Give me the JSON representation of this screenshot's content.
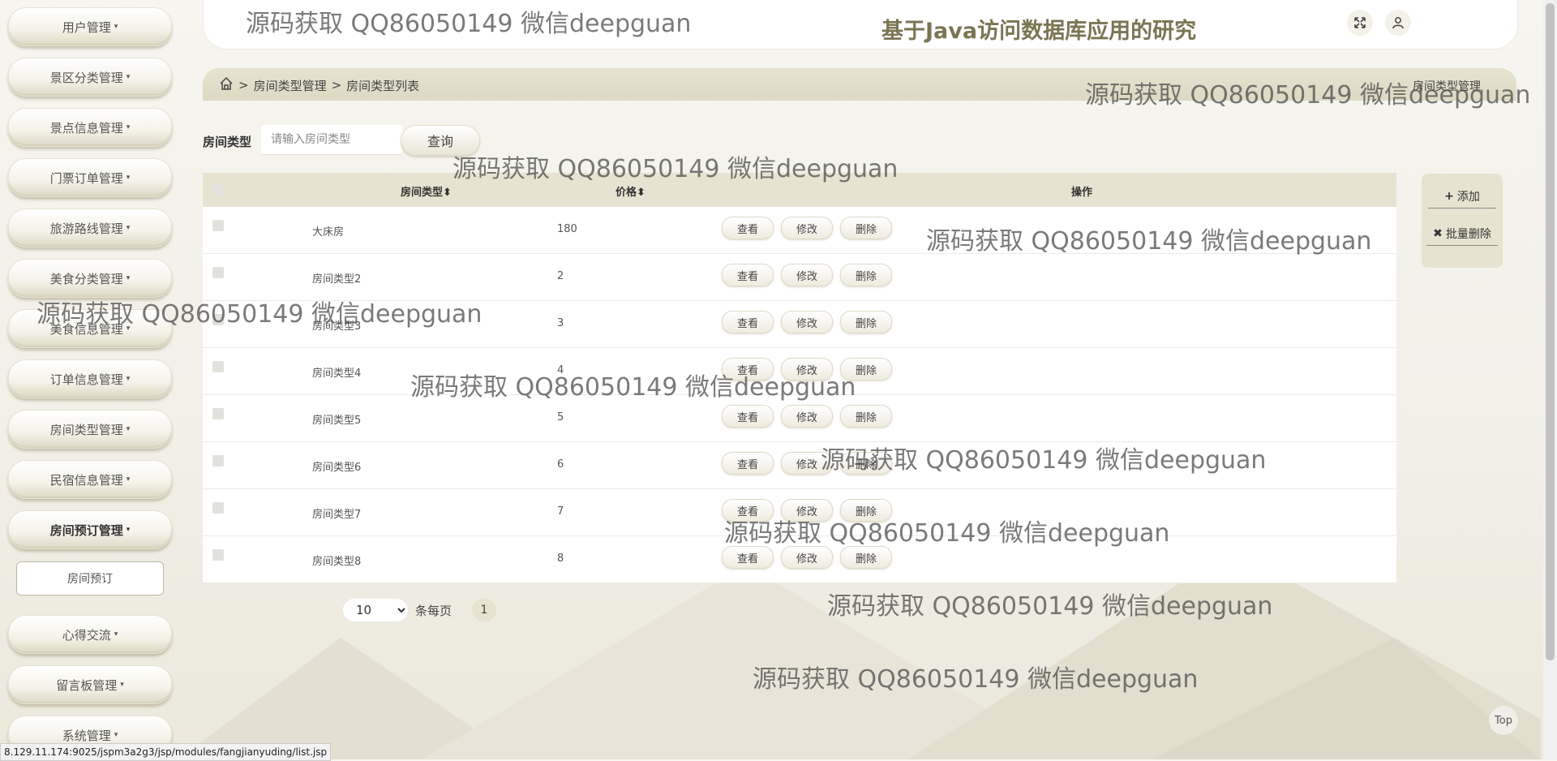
{
  "header": {
    "title": "基于Java访问数据库应用的研究"
  },
  "sidebar": {
    "items": [
      {
        "label": "用户管理"
      },
      {
        "label": "景区分类管理"
      },
      {
        "label": "景点信息管理"
      },
      {
        "label": "门票订单管理"
      },
      {
        "label": "旅游路线管理"
      },
      {
        "label": "美食分类管理"
      },
      {
        "label": "美食信息管理"
      },
      {
        "label": "订单信息管理"
      },
      {
        "label": "房间类型管理"
      },
      {
        "label": "民宿信息管理"
      },
      {
        "label": "房间预订管理"
      },
      {
        "label": "心得交流"
      },
      {
        "label": "留言板管理"
      },
      {
        "label": "系统管理"
      }
    ],
    "submenu": {
      "label": "房间预订"
    }
  },
  "breadcrumb": {
    "home_icon": "home-icon",
    "sep": ">",
    "level1": "房间类型管理",
    "level2": "房间类型列表",
    "right": "房间类型管理"
  },
  "search": {
    "label": "房间类型",
    "placeholder": "请输入房间类型",
    "button": "查询"
  },
  "table": {
    "headers": {
      "type": "房间类型",
      "price": "价格",
      "ops": "操作"
    },
    "rows": [
      {
        "type": "大床房",
        "price": "180"
      },
      {
        "type": "房间类型2",
        "price": "2"
      },
      {
        "type": "房间类型3",
        "price": "3"
      },
      {
        "type": "房间类型4",
        "price": "4"
      },
      {
        "type": "房间类型5",
        "price": "5"
      },
      {
        "type": "房间类型6",
        "price": "6"
      },
      {
        "type": "房间类型7",
        "price": "7"
      },
      {
        "type": "房间类型8",
        "price": "8"
      }
    ],
    "actions": {
      "view": "查看",
      "edit": "修改",
      "delete": "删除"
    }
  },
  "right_panel": {
    "add": "添加",
    "batch_delete": "批量删除"
  },
  "pagination": {
    "page_size": "10",
    "per_page_label": "条每页",
    "current_page": "1"
  },
  "top_button": "Top",
  "status_url": "8.129.11.174:9025/jspm3a2g3/jsp/modules/fangjianyuding/list.jsp",
  "watermark": "源码获取 QQ86050149 微信deepguan",
  "colors": {
    "accent": "#7a7552",
    "panel": "#e6e3d0"
  }
}
